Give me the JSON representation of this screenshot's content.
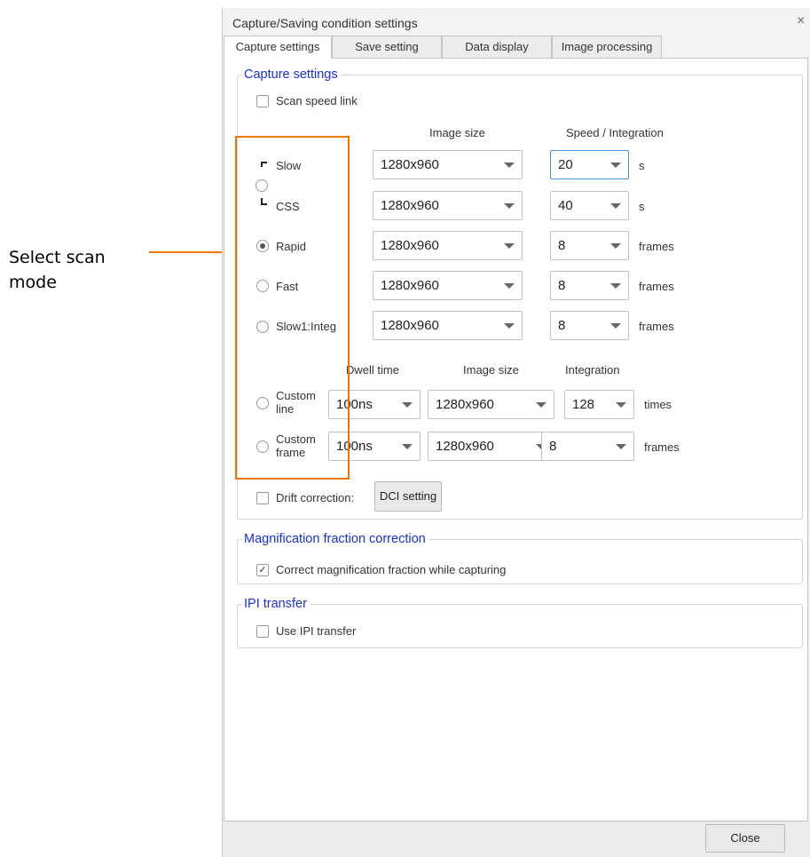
{
  "annotation": {
    "text": "Select scan mode"
  },
  "dialog": {
    "title": "Capture/Saving condition settings",
    "close_icon": "×"
  },
  "tabs": [
    {
      "label": "Capture settings",
      "active": true
    },
    {
      "label": "Save setting"
    },
    {
      "label": "Data display"
    },
    {
      "label": "Image processing"
    }
  ],
  "capture": {
    "legend": "Capture settings",
    "scan_speed_link": {
      "label": "Scan speed link",
      "checked": false
    },
    "headers": {
      "image_size": "Image size",
      "speed_integration": "Speed / Integration"
    },
    "modes": [
      {
        "label": "Slow",
        "size": "1280x960",
        "value": "20",
        "unit": "s"
      },
      {
        "label": "CSS",
        "size": "1280x960",
        "value": "40",
        "unit": "s"
      },
      {
        "label": "Rapid",
        "size": "1280x960",
        "value": "8",
        "unit": "frames",
        "selected": true
      },
      {
        "label": "Fast",
        "size": "1280x960",
        "value": "8",
        "unit": "frames"
      },
      {
        "label": "Slow1:Integ",
        "size": "1280x960",
        "value": "8",
        "unit": "frames"
      }
    ],
    "custom_headers": {
      "dwell": "Dwell time",
      "image_size": "Image size",
      "integration": "Integration"
    },
    "custom_modes": [
      {
        "label1": "Custom",
        "label2": "line",
        "dwell": "100ns",
        "size": "1280x960",
        "value": "128",
        "unit": "times"
      },
      {
        "label1": "Custom",
        "label2": "frame",
        "dwell": "100ns",
        "size": "1280x960",
        "value": "8",
        "unit": "frames"
      }
    ],
    "drift": {
      "label": "Drift correction:",
      "button": "DCI setting",
      "checked": false
    }
  },
  "magnification": {
    "legend": "Magnification fraction correction",
    "check_label": "Correct magnification fraction while capturing",
    "check_mark": "✓",
    "checked": true
  },
  "ipi": {
    "legend": "IPI transfer",
    "check_label": "Use IPI transfer",
    "checked": false
  },
  "footer": {
    "close_label": "Close"
  }
}
